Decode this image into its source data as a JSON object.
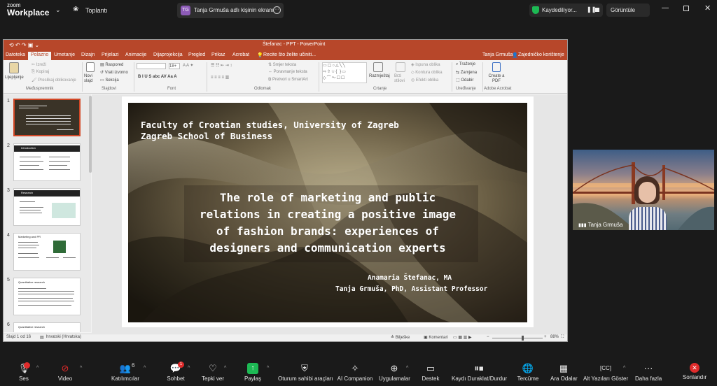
{
  "zoom": {
    "logo_top": "zoom",
    "logo_bottom": "Workplace",
    "meeting_label": "Toplantı",
    "share_label": "Tanja Grmuša adlı kişinin ekranı",
    "share_initials": "TG",
    "recording_label": "Kaydediliyor...",
    "view_label": "Görüntüle",
    "colors": {
      "bg": "#1a1a1a",
      "green": "#1db954",
      "red": "#e02b2b"
    }
  },
  "ppt": {
    "title": "Štefanac - PPT - PowerPoint",
    "tabs": [
      "Datoteka",
      "Polazno",
      "Umetanje",
      "Dizajn",
      "Prijelazi",
      "Animacije",
      "Dijaprojekcija",
      "Pregled",
      "Prikaz",
      "Acrobat"
    ],
    "search": "Recite što želite učiniti...",
    "user": "Tanja Grmuša",
    "share": "Zajedničko korištenje",
    "ribbon": {
      "paste": "Lijepljenje",
      "cut": "Izreži",
      "copy": "Kopiraj",
      "format_painter": "Preslikaj oblikovanje",
      "clipboard_group": "Međuspremnik",
      "new_slide": "Novi slajd",
      "layout": "Raspored",
      "reset": "Vrati izvorno",
      "section": "Sekcija",
      "slides_group": "Slajdovi",
      "font_size": "18+",
      "font_group": "Font",
      "text_direction": "Smjer teksta",
      "align_text": "Poravnanje teksta",
      "smartart": "Pretvori u SmartArt",
      "paragraph_group": "Odlomak",
      "arrange": "Razmještaj",
      "quick_styles": "Brzi stilovi",
      "fill": "Ispuna oblika",
      "outline": "Kontura oblika",
      "effects": "Efekti oblika",
      "drawing_group": "Crtanje",
      "find": "Traženje",
      "replace": "Zamjena",
      "select": "Odabir",
      "editing_group": "Uređivanje",
      "create_pdf": "Create a PDF",
      "acrobat_group": "Adobe Acrobat"
    },
    "thumbs": [
      "1",
      "2",
      "3",
      "4",
      "5",
      "6"
    ],
    "thumb_titles": [
      "",
      "Introduction",
      "Research",
      "Marketing and PR",
      "Quantitative research",
      "Quantitative research"
    ],
    "slide": {
      "line1": "Faculty of Croatian studies, University of Zagreb",
      "line2": "Zagreb School of Business",
      "title_lines": [
        "The role of marketing and public",
        "relations in creating a positive image",
        "of fashion brands: experiences of",
        "designers and communication experts"
      ],
      "author1": "Anamaria Štefanac, MA",
      "author2": "Tanja Grmuša, PhD, Assistant Professor"
    },
    "status": {
      "slide_count": "Slajd 1 od 16",
      "language": "hrvatski (Hrvatska)",
      "notes": "Bilješke",
      "comments": "Komentari",
      "zoom": "88%"
    }
  },
  "camera": {
    "name": "Tanja Grmuša"
  },
  "bottom": [
    {
      "label": "Ses",
      "icon": "mic-icon"
    },
    {
      "label": "Video",
      "icon": "video-off-icon"
    },
    {
      "label": "Katılımcılar",
      "icon": "participants-icon",
      "count": "6"
    },
    {
      "label": "Sohbet",
      "icon": "chat-icon",
      "badge": "1"
    },
    {
      "label": "Tepki ver",
      "icon": "heart-icon"
    },
    {
      "label": "Paylaş",
      "icon": "share-screen-icon"
    },
    {
      "label": "Oturum sahibi araçları",
      "icon": "shield-icon"
    },
    {
      "label": "AI Companion",
      "icon": "ai-sparkle-icon"
    },
    {
      "label": "Uygulamalar",
      "icon": "apps-icon"
    },
    {
      "label": "Destek",
      "icon": "cast-icon"
    },
    {
      "label": "Kaydı Duraklat/Durdur",
      "icon": "record-pause-icon"
    },
    {
      "label": "Tercüme",
      "icon": "globe-icon"
    },
    {
      "label": "Ara Odalar",
      "icon": "breakout-icon"
    },
    {
      "label": "Alt Yazıları Göster",
      "icon": "captions-icon"
    },
    {
      "label": "Daha fazla",
      "icon": "more-icon"
    },
    {
      "label": "Sonlandır",
      "icon": "end-icon"
    }
  ]
}
